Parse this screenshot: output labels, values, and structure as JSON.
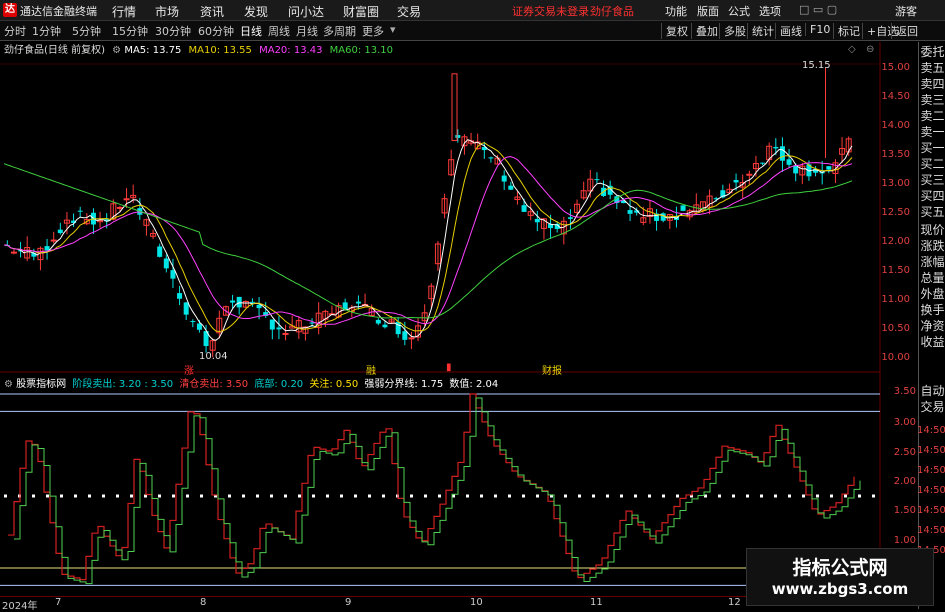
{
  "titlebar": {
    "app_title": "通达信金融终端",
    "menus": [
      "行情",
      "市场",
      "资讯",
      "发现",
      "问小达",
      "财富圈",
      "交易"
    ],
    "notice": "证券交易未登录",
    "stock": "劲仔食品",
    "right_menus": [
      "功能",
      "版面",
      "公式",
      "选项"
    ],
    "guest": "游客"
  },
  "toolbar": {
    "periods": [
      "分时",
      "1分钟",
      "5分钟",
      "15分钟",
      "30分钟",
      "60分钟",
      "日线",
      "周线",
      "月线",
      "多周期",
      "更多"
    ],
    "selected": "日线",
    "buttons": [
      "复权",
      "叠加",
      "多股",
      "统计",
      "画线",
      "F10",
      "标记",
      "+自选",
      "返回"
    ]
  },
  "info": {
    "name": "劲仔食品(日线 前复权)",
    "ma5": "MA5: 13.75",
    "ma10": "MA10: 13.55",
    "ma20": "MA20: 13.43",
    "ma60": "MA60: 13.10"
  },
  "colors": {
    "up": "#ff3b3b",
    "down": "#00e5e5",
    "ma5": "#ffffff",
    "ma10": "#e8d000",
    "ma20": "#ff40ff",
    "ma60": "#3fcf3f"
  },
  "price_axis": [
    "15.00",
    "14.50",
    "14.00",
    "13.50",
    "13.00",
    "12.50",
    "12.00",
    "11.50",
    "11.00",
    "10.50",
    "10.00"
  ],
  "annotations": {
    "high": "15.15",
    "low": "10.04",
    "tag1": "涨",
    "tag2": "融",
    "tag3": "财报"
  },
  "right_panel": [
    "委托",
    "卖五",
    "卖四",
    "卖三",
    "卖二",
    "卖一",
    "买一",
    "买二",
    "买三",
    "买四",
    "买五",
    "现价",
    "涨跌",
    "涨幅",
    "总量",
    "外盘",
    "换手",
    "净资",
    "收益",
    "自动",
    "交易"
  ],
  "indicator": {
    "name": "股票指标网",
    "s1": "阶段卖出: 3.20 : 3.50",
    "s2": "清仓卖出: 3.50",
    "s3": "底部: 0.20",
    "s4": "关注: 0.50",
    "s5": "强弱分界线: 1.75",
    "s6": "数值: 2.04"
  },
  "ind_axis": [
    "3.50",
    "3.00",
    "2.50",
    "2.00",
    "1.50",
    "1.00"
  ],
  "ind_axis_right": [
    "14:50",
    "14:50",
    "14:50",
    "14:50",
    "14:50",
    "14:50",
    "14:50"
  ],
  "xaxis": [
    "2024年",
    "7",
    "8",
    "9",
    "10",
    "11",
    "12"
  ],
  "watermark": {
    "line1": "指标公式网",
    "line2": "www.zbgs3.com"
  }
}
